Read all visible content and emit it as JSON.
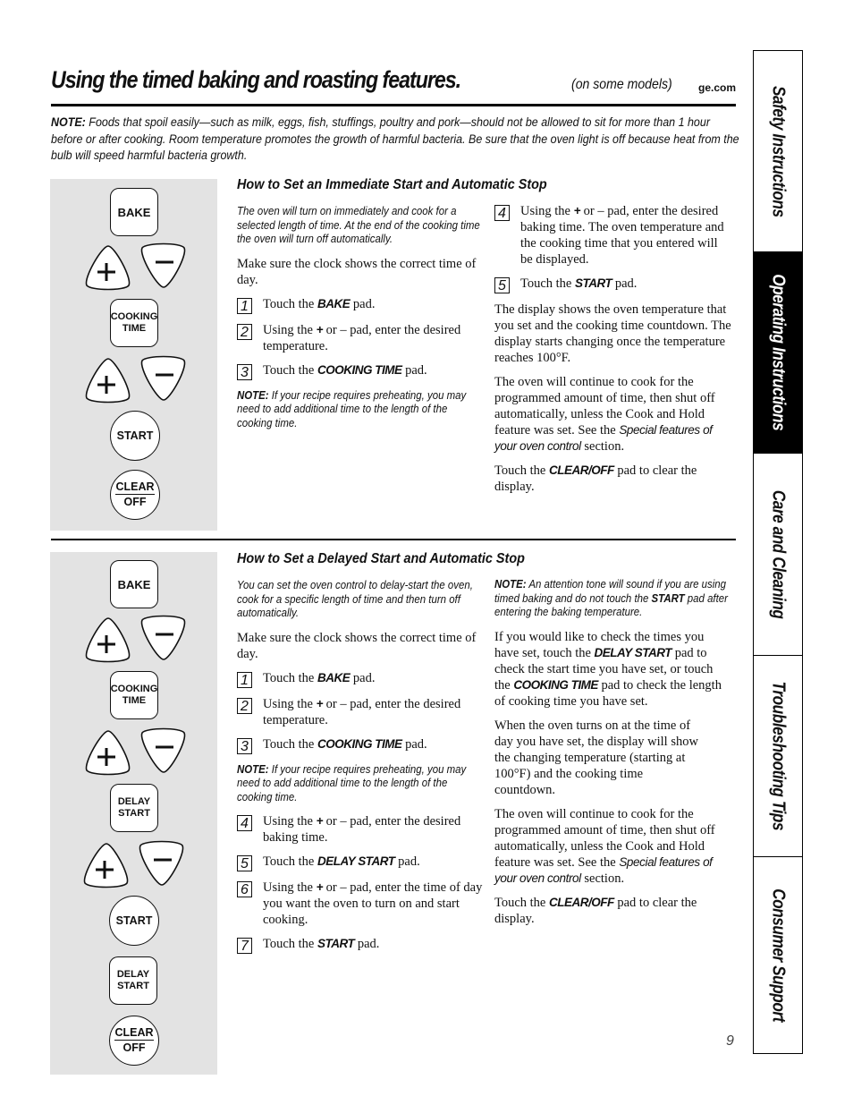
{
  "header": {
    "title": "Using the timed baking and roasting features.",
    "subtitle": "(on some models)",
    "site": "ge.com"
  },
  "top_note": {
    "label": "NOTE:",
    "text": " Foods that spoil easily—such as milk, eggs, fish, stuffings, poultry and pork—should not be allowed to sit for more than 1 hour before or after cooking. Room temperature promotes the growth of harmful bacteria. Be sure that the oven light is off because heat from the bulb will speed harmful bacteria growth."
  },
  "pads": {
    "bake": "BAKE",
    "plus": "+",
    "minus": "−",
    "cooking": "COOKING",
    "time": "TIME",
    "start": "START",
    "clear": "CLEAR",
    "off": "OFF",
    "delay": "DELAY",
    "delay_start": "START"
  },
  "immediate": {
    "heading": "How to Set an Immediate Start and Automatic Stop",
    "intro": "The oven will turn on immediately and cook for a selected length of time. At the end of the cooking time the oven will turn off automatically.",
    "clock": "Make sure the clock shows the correct time of day.",
    "steps": [
      {
        "num": "1",
        "pre": "Touch the ",
        "bold": "BAKE",
        "post": " pad."
      },
      {
        "num": "2",
        "pre": "Using the ",
        "bold": "+",
        "post": " or – pad, enter the desired temperature."
      },
      {
        "num": "3",
        "pre": "Touch the ",
        "bold": "COOKING TIME",
        "post": " pad."
      },
      {
        "num": "4",
        "pre": "Using the ",
        "bold": "+",
        "post": " or – pad, enter the desired baking time. The oven temperature and the cooking time that you entered will be displayed."
      },
      {
        "num": "5",
        "pre": "Touch the ",
        "bold": "START",
        "post": " pad."
      }
    ],
    "note_label": "NOTE:",
    "note_text": " If your recipe requires preheating, you may need to add additional time to the length of the cooking time.",
    "display_text": "The display shows the oven temperature that you set and the cooking time countdown. The display starts changing once the temperature reaches 100°F.",
    "continue_pre": "The oven will continue to cook for the programmed amount of time, then shut off automatically, unless the Cook and Hold feature was set. See the ",
    "continue_ital": "Special features of your oven control",
    "continue_post": " section.",
    "clear_pre": "Touch the ",
    "clear_bold": "CLEAR/OFF",
    "clear_post": " pad to clear the display."
  },
  "delayed": {
    "heading": "How to Set a Delayed Start and Automatic Stop",
    "intro": "You can set the oven control to delay-start the oven, cook for a specific length of time and then turn off automatically.",
    "clock": "Make sure the clock shows the correct time of day.",
    "steps": [
      {
        "num": "1",
        "pre": "Touch the ",
        "bold": "BAKE",
        "post": " pad."
      },
      {
        "num": "2",
        "pre": "Using the ",
        "bold": "+",
        "post": " or – pad, enter the desired temperature."
      },
      {
        "num": "3",
        "pre": "Touch the ",
        "bold": "COOKING TIME",
        "post": " pad."
      },
      {
        "num": "4",
        "pre": "Using the ",
        "bold": "+",
        "post": " or – pad, enter the desired baking time."
      },
      {
        "num": "5",
        "pre": "Touch the ",
        "bold": "DELAY START",
        "post": " pad."
      },
      {
        "num": "6",
        "pre": "Using the ",
        "bold": "+",
        "post": " or – pad, enter the time of day you want the oven to turn on and start cooking."
      },
      {
        "num": "7",
        "pre": "Touch the ",
        "bold": "START",
        "post": " pad."
      }
    ],
    "note_label": "NOTE:",
    "note_text": " If your recipe requires preheating, you may need to add additional time to the length of the cooking time.",
    "tone_label": "NOTE:",
    "tone_pre": " An attention tone will sound if you are using timed baking and do not touch the ",
    "tone_bold": "START",
    "tone_post": " pad after entering the baking temperature.",
    "check_pre": "If you would like to check the times you have set, touch the ",
    "check_bold1": "DELAY START",
    "check_mid": " pad to check the start time you have set, or touch the ",
    "check_bold2": "COOKING TIME",
    "check_post": " pad to check the length of cooking time you have set.",
    "turns_on": "When the oven turns on at the time of day you have set, the display will show the changing temperature (starting at 100°F) and the cooking time countdown.",
    "continue_pre": "The oven will continue to cook for the programmed amount of time, then shut off automatically, unless the Cook and Hold feature was set. See the ",
    "continue_ital": "Special features of your oven control",
    "continue_post": " section.",
    "clear_pre": "Touch the ",
    "clear_bold": "CLEAR/OFF",
    "clear_post": " pad to clear the display."
  },
  "side_tabs": [
    {
      "label": "Safety Instructions",
      "active": false
    },
    {
      "label": "Operating Instructions",
      "active": true
    },
    {
      "label": "Care and Cleaning",
      "active": false
    },
    {
      "label": "Troubleshooting Tips",
      "active": false
    },
    {
      "label": "Consumer Support",
      "active": false
    }
  ],
  "page_number": "9",
  "colors": {
    "panel_bg": "#e3e3e3",
    "active_tab_bg": "#000000",
    "text": "#111111"
  }
}
